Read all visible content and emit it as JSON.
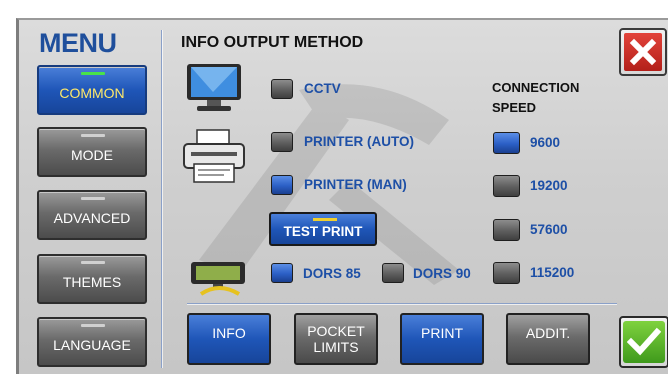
{
  "menu": {
    "title": "MENU",
    "items": [
      {
        "label": "COMMON",
        "active": true
      },
      {
        "label": "MODE",
        "active": false
      },
      {
        "label": "ADVANCED",
        "active": false
      },
      {
        "label": "THEMES",
        "active": false
      },
      {
        "label": "LANGUAGE",
        "active": false
      }
    ]
  },
  "section": {
    "title": "INFO OUTPUT METHOD"
  },
  "outputs": {
    "cctv": {
      "label": "CCTV",
      "checked": false
    },
    "printer_auto": {
      "label": "PRINTER (AUTO)",
      "checked": false
    },
    "printer_man": {
      "label": "PRINTER (MAN)",
      "checked": true
    },
    "test_print": {
      "label": "TEST PRINT"
    },
    "dors85": {
      "label": "DORS 85",
      "checked": true
    },
    "dors90": {
      "label": "DORS 90",
      "checked": false
    }
  },
  "connection_speed": {
    "heading_line1": "CONNECTION",
    "heading_line2": "SPEED",
    "options": [
      {
        "label": "9600",
        "checked": true
      },
      {
        "label": "19200",
        "checked": false
      },
      {
        "label": "57600",
        "checked": false
      },
      {
        "label": "115200",
        "checked": false
      }
    ]
  },
  "bottom_buttons": {
    "info": "INFO",
    "pocket_limits_line1": "POCKET",
    "pocket_limits_line2": "LIMITS",
    "print": "PRINT",
    "addit": "ADDIT."
  },
  "colors": {
    "accent_blue": "#1f56b8",
    "label_blue": "#1d4fa6",
    "close_red": "#c8281f",
    "ok_green": "#5cb82d",
    "active_bar_green": "#49e24a"
  },
  "icons": {
    "close": "close-icon",
    "confirm": "checkmark-icon",
    "monitor": "monitor-icon",
    "printer": "printer-icon",
    "display": "dors-display-icon"
  }
}
